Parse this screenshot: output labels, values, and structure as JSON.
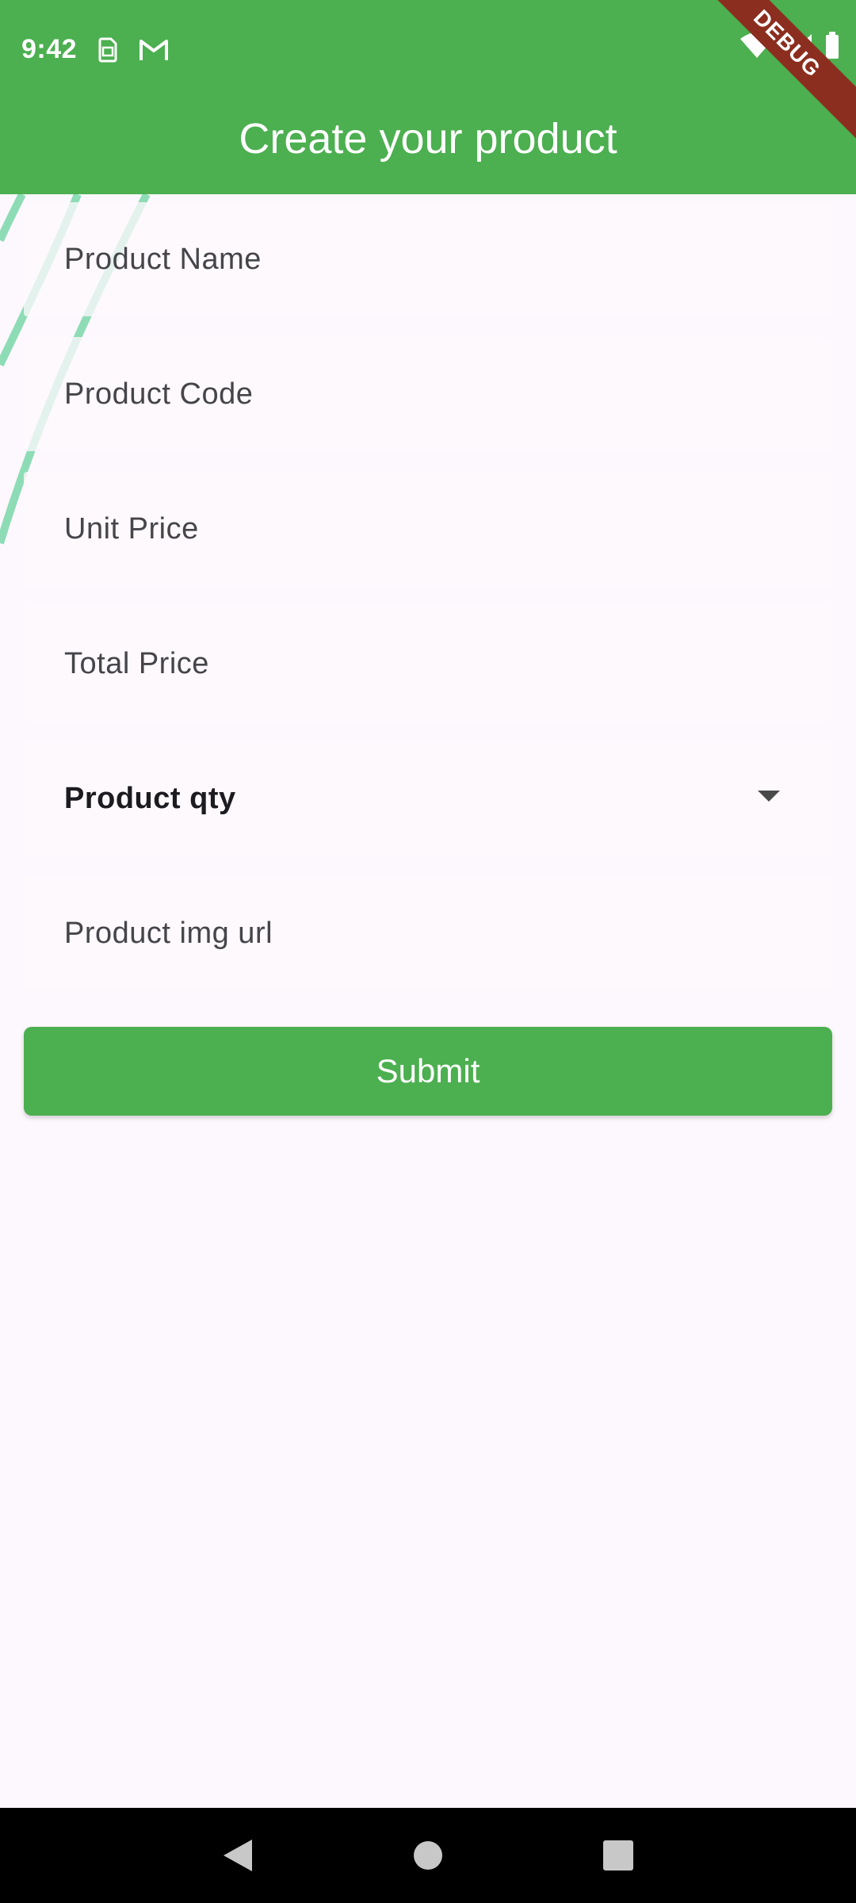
{
  "status_bar": {
    "time": "9:42",
    "icons": [
      "sim-card-icon",
      "gmail-icon",
      "wifi-icon",
      "signal-icon",
      "battery-icon"
    ]
  },
  "app_bar": {
    "title": "Create your product",
    "color": "#4caf50",
    "debug_banner": "DEBUG"
  },
  "form": {
    "fields": [
      {
        "label": "Product Name"
      },
      {
        "label": "Product Code"
      },
      {
        "label": "Unit Price"
      },
      {
        "label": "Total Price"
      },
      {
        "label": "Product qty"
      },
      {
        "label": "Product img url"
      }
    ],
    "submit_label": "Submit"
  },
  "nav_bar": {
    "buttons": [
      "back-icon",
      "home-icon",
      "recents-icon"
    ]
  }
}
